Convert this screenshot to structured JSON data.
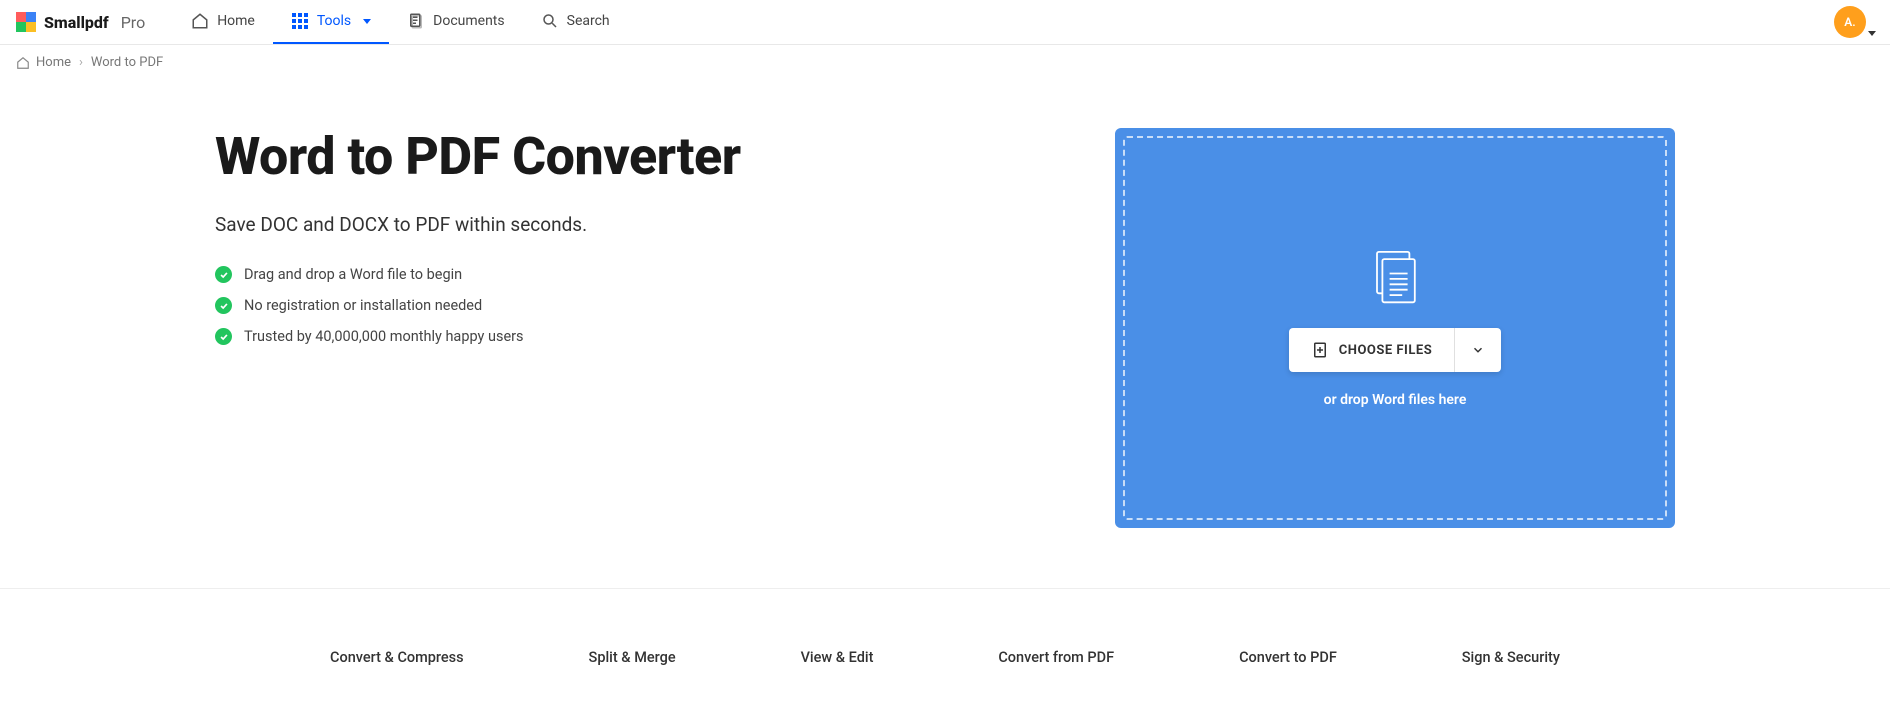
{
  "brand": {
    "name": "Smallpdf",
    "tier": "Pro"
  },
  "nav": {
    "home": "Home",
    "tools": "Tools",
    "documents": "Documents",
    "search": "Search"
  },
  "avatar": {
    "initials": "A."
  },
  "breadcrumb": {
    "home": "Home",
    "current": "Word to PDF"
  },
  "hero": {
    "title": "Word to PDF Converter",
    "subtitle": "Save DOC and DOCX to PDF within seconds.",
    "bullets": [
      "Drag and drop a Word file to begin",
      "No registration or installation needed",
      "Trusted by 40,000,000 monthly happy users"
    ]
  },
  "dropzone": {
    "choose_label": "CHOOSE FILES",
    "hint": "or drop Word files here"
  },
  "categories": [
    "Convert & Compress",
    "Split & Merge",
    "View & Edit",
    "Convert from PDF",
    "Convert to PDF",
    "Sign & Security"
  ]
}
